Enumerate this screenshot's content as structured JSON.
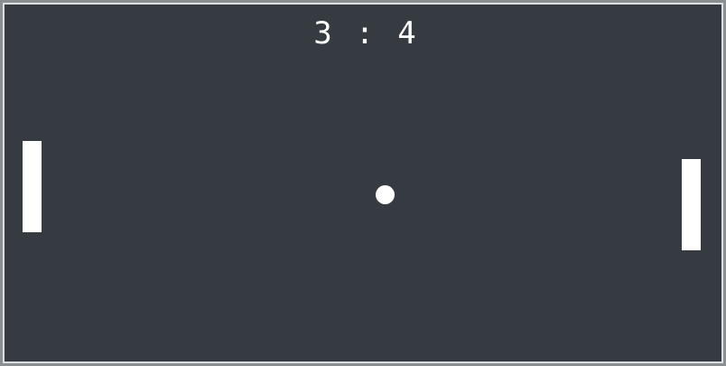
{
  "game": {
    "type": "pong",
    "score": {
      "left": "3",
      "separator": ":",
      "right": "4"
    },
    "colors": {
      "background": "#363b42",
      "foreground": "#ffffff",
      "border": "#dcdee0"
    }
  }
}
